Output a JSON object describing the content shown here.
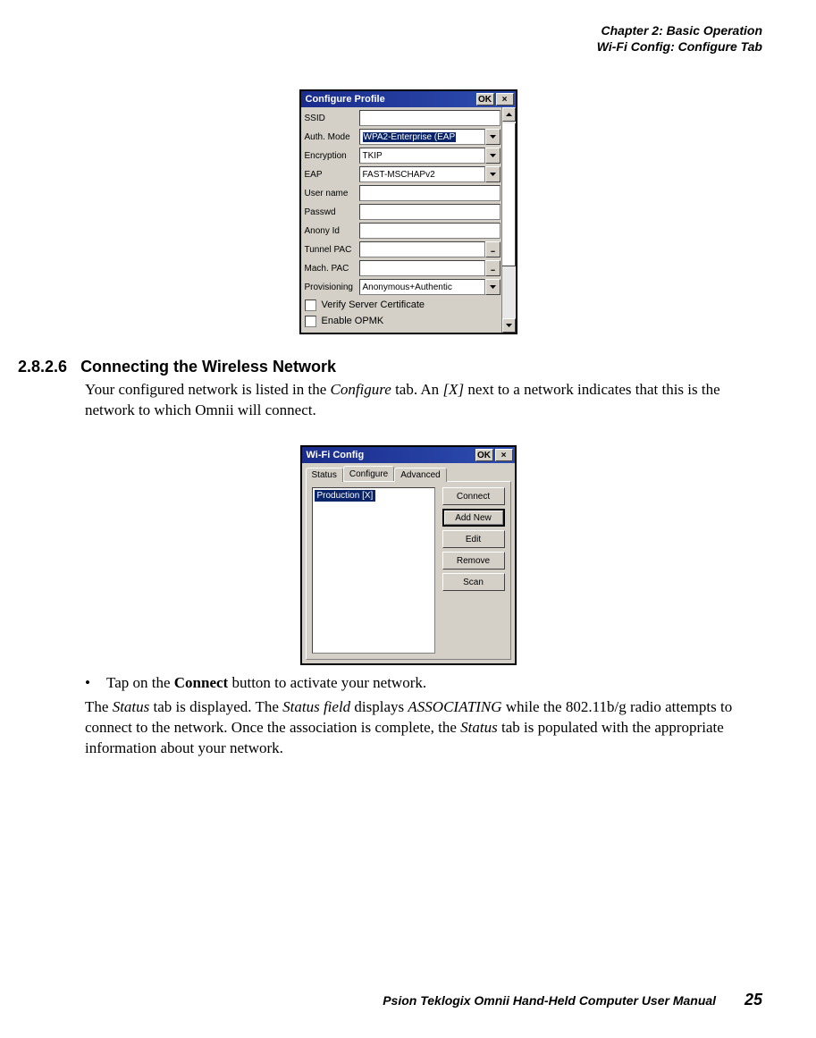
{
  "header": {
    "line1": "Chapter 2:  Basic Operation",
    "line2": "Wi-Fi Config: Configure Tab"
  },
  "dlg1": {
    "title": "Configure Profile",
    "ok": "OK",
    "fields": {
      "ssid_lbl": "SSID",
      "auth_lbl": "Auth. Mode",
      "auth_val": "WPA2-Enterprise (EAP",
      "enc_lbl": "Encryption",
      "enc_val": "TKIP",
      "eap_lbl": "EAP",
      "eap_val": "FAST-MSCHAPv2",
      "user_lbl": "User name",
      "pass_lbl": "Passwd",
      "anon_lbl": "Anony Id",
      "tpac_lbl": "Tunnel PAC",
      "mpac_lbl": "Mach. PAC",
      "prov_lbl": "Provisioning",
      "prov_val": "Anonymous+Authentic",
      "browse": "...",
      "chk1": "Verify Server Certificate",
      "chk2": "Enable OPMK"
    }
  },
  "section": {
    "number": "2.8.2.6",
    "title": "Connecting the Wireless Network",
    "p1a": "Your configured network is listed in the ",
    "p1b_em": "Configure",
    "p1c": " tab. An ",
    "p1d_em": "[X]",
    "p1e": " next to a network indicates that this is the network to which Omnii will connect."
  },
  "dlg2": {
    "title": "Wi-Fi Config",
    "ok": "OK",
    "tabs": {
      "status": "Status",
      "configure": "Configure",
      "advanced": "Advanced"
    },
    "profile": "Production [X]",
    "buttons": {
      "connect": "Connect",
      "add": "Add New",
      "edit": "Edit",
      "remove": "Remove",
      "scan": "Scan"
    }
  },
  "after": {
    "bullet": "Tap on the ",
    "bullet_b": "Connect",
    "bullet_c": " button to activate your network.",
    "p2a": "The ",
    "p2b_em": "Status",
    "p2c": " tab is displayed. The ",
    "p2d_em": "Status field",
    "p2e": " displays ",
    "p2f_em": "ASSOCIATING",
    "p2g": " while the 802.11b/g radio attempts to connect to the network. Once the association is complete, the ",
    "p2h_em": "Status",
    "p2i": " tab is populated with the appropriate information about your network."
  },
  "footer": {
    "text": "Psion Teklogix Omnii Hand-Held Computer User Manual",
    "page": "25"
  }
}
